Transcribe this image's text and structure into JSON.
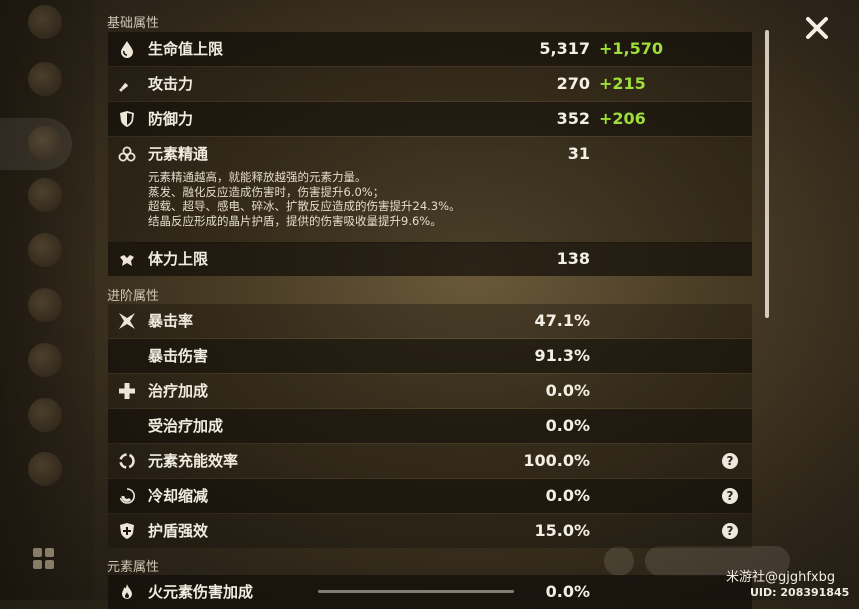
{
  "sections": {
    "base": "基础属性",
    "advanced": "进阶属性",
    "elemental": "元素属性"
  },
  "base_stats": [
    {
      "label": "生命值上限",
      "value": "5,317",
      "bonus": "+1,570",
      "icon": "hp-drop-icon"
    },
    {
      "label": "攻击力",
      "value": "270",
      "bonus": "+215",
      "icon": "sword-icon"
    },
    {
      "label": "防御力",
      "value": "352",
      "bonus": "+206",
      "icon": "shield-icon"
    },
    {
      "label": "元素精通",
      "value": "31",
      "icon": "elemental-mastery-icon"
    },
    {
      "label": "体力上限",
      "value": "138",
      "icon": "stamina-icon"
    }
  ],
  "mastery_desc": [
    "元素精通越高，就能释放越强的元素力量。",
    "蒸发、融化反应造成伤害时，伤害提升6.0%；",
    "超载、超导、感电、碎冰、扩散反应造成的伤害提升24.3%。",
    "结晶反应形成的晶片护盾，提供的伤害吸收量提升9.6%。"
  ],
  "advanced_stats": [
    {
      "label": "暴击率",
      "value": "47.1%",
      "icon": "crit-rate-icon"
    },
    {
      "label": "暴击伤害",
      "value": "91.3%"
    },
    {
      "label": "治疗加成",
      "value": "0.0%",
      "icon": "healing-cross-icon"
    },
    {
      "label": "受治疗加成",
      "value": "0.0%"
    },
    {
      "label": "元素充能效率",
      "value": "100.0%",
      "icon": "energy-recharge-icon",
      "help": "?"
    },
    {
      "label": "冷却缩减",
      "value": "0.0%",
      "icon": "cooldown-icon",
      "help": "?"
    },
    {
      "label": "护盾强效",
      "value": "15.0%",
      "icon": "shield-strength-icon",
      "help": "?"
    }
  ],
  "elemental_stats": [
    {
      "label": "火元素伤害加成",
      "value": "0.0%",
      "icon": "pyro-icon"
    }
  ],
  "watermark": "米游社@gjghfxbg",
  "uid": "UID: 208391845",
  "colors": {
    "bonus": "#9fde3a",
    "row_dark": "#120e08",
    "text": "#ece5d8"
  }
}
